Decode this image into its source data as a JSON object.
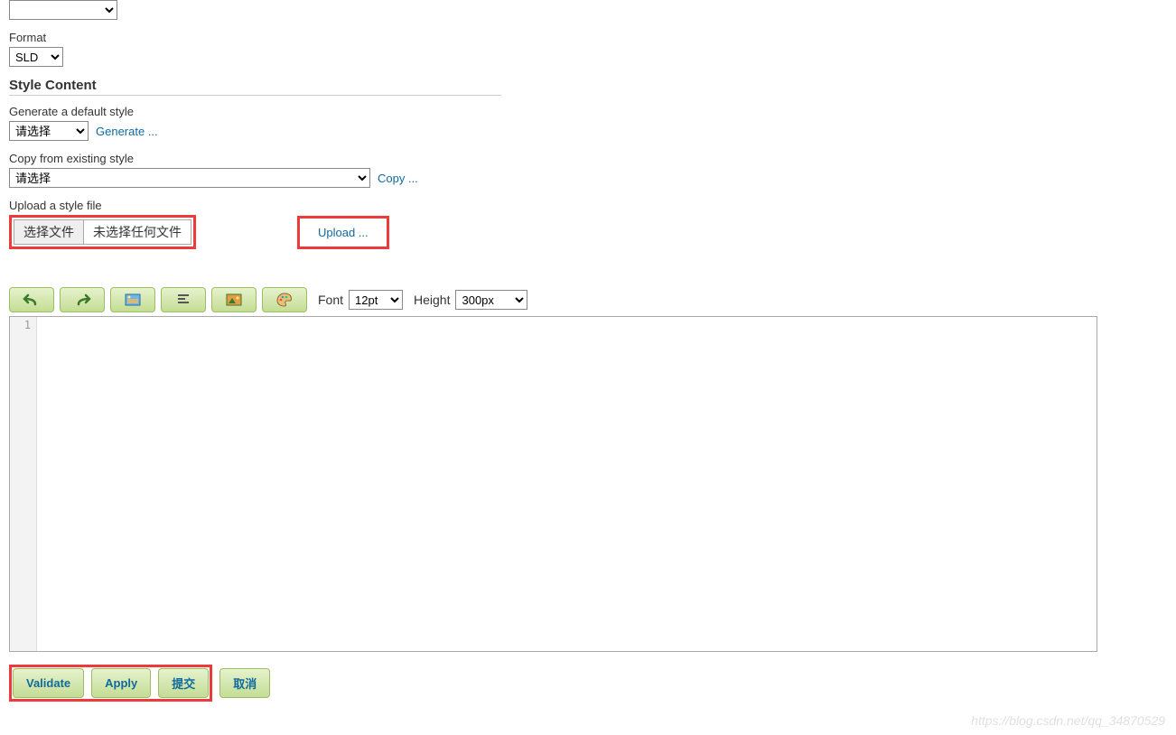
{
  "top_select": {
    "value": ""
  },
  "format": {
    "label": "Format",
    "value": "SLD"
  },
  "style_content": {
    "heading": "Style Content",
    "generate_label": "Generate a default style",
    "generate_select": "请选择",
    "generate_link": "Generate ...",
    "copy_label": "Copy from existing style",
    "copy_select": "请选择",
    "copy_link": "Copy ...",
    "upload_label": "Upload a style file",
    "file_button": "选择文件",
    "file_status": "未选择任何文件",
    "upload_link": "Upload ..."
  },
  "toolbar": {
    "font_label": "Font",
    "font_value": "12pt",
    "height_label": "Height",
    "height_value": "300px"
  },
  "editor": {
    "line_number": "1"
  },
  "actions": {
    "validate": "Validate",
    "apply": "Apply",
    "submit": "提交",
    "cancel": "取消"
  },
  "watermark": "https://blog.csdn.net/qq_34870529"
}
